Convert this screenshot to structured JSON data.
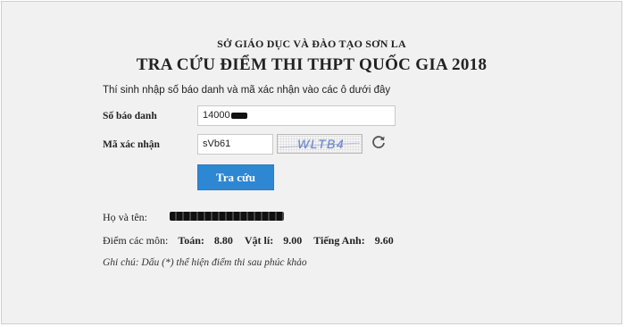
{
  "header": {
    "department": "SỞ GIÁO DỤC VÀ ĐÀO TẠO SƠN LA",
    "title": "TRA CỨU ĐIỂM THI THPT QUỐC GIA 2018"
  },
  "form": {
    "intro": "Thí sinh nhập số báo danh và mã xác nhận vào các ô dưới đây",
    "sbd_label": "Số báo danh",
    "sbd_value": "14000",
    "captcha_label": "Mã xác nhận",
    "captcha_input_value": "sVb61",
    "captcha_image_text": "WLTB4",
    "refresh_icon": "refresh-icon",
    "submit_label": "Tra cứu"
  },
  "result": {
    "name_label": "Họ và tên:",
    "scores_label": "Điểm các môn:",
    "scores": [
      {
        "subject": "Toán:",
        "score": "8.80"
      },
      {
        "subject": "Vật lí:",
        "score": "9.00"
      },
      {
        "subject": "Tiếng Anh:",
        "score": "9.60"
      }
    ],
    "note": "Ghi chú: Dấu (*) thể hiện điểm thi sau phúc khảo"
  },
  "colors": {
    "button_bg": "#2e87d2",
    "panel_bg": "#f1f1f1",
    "captcha_text": "#6f88c9"
  }
}
